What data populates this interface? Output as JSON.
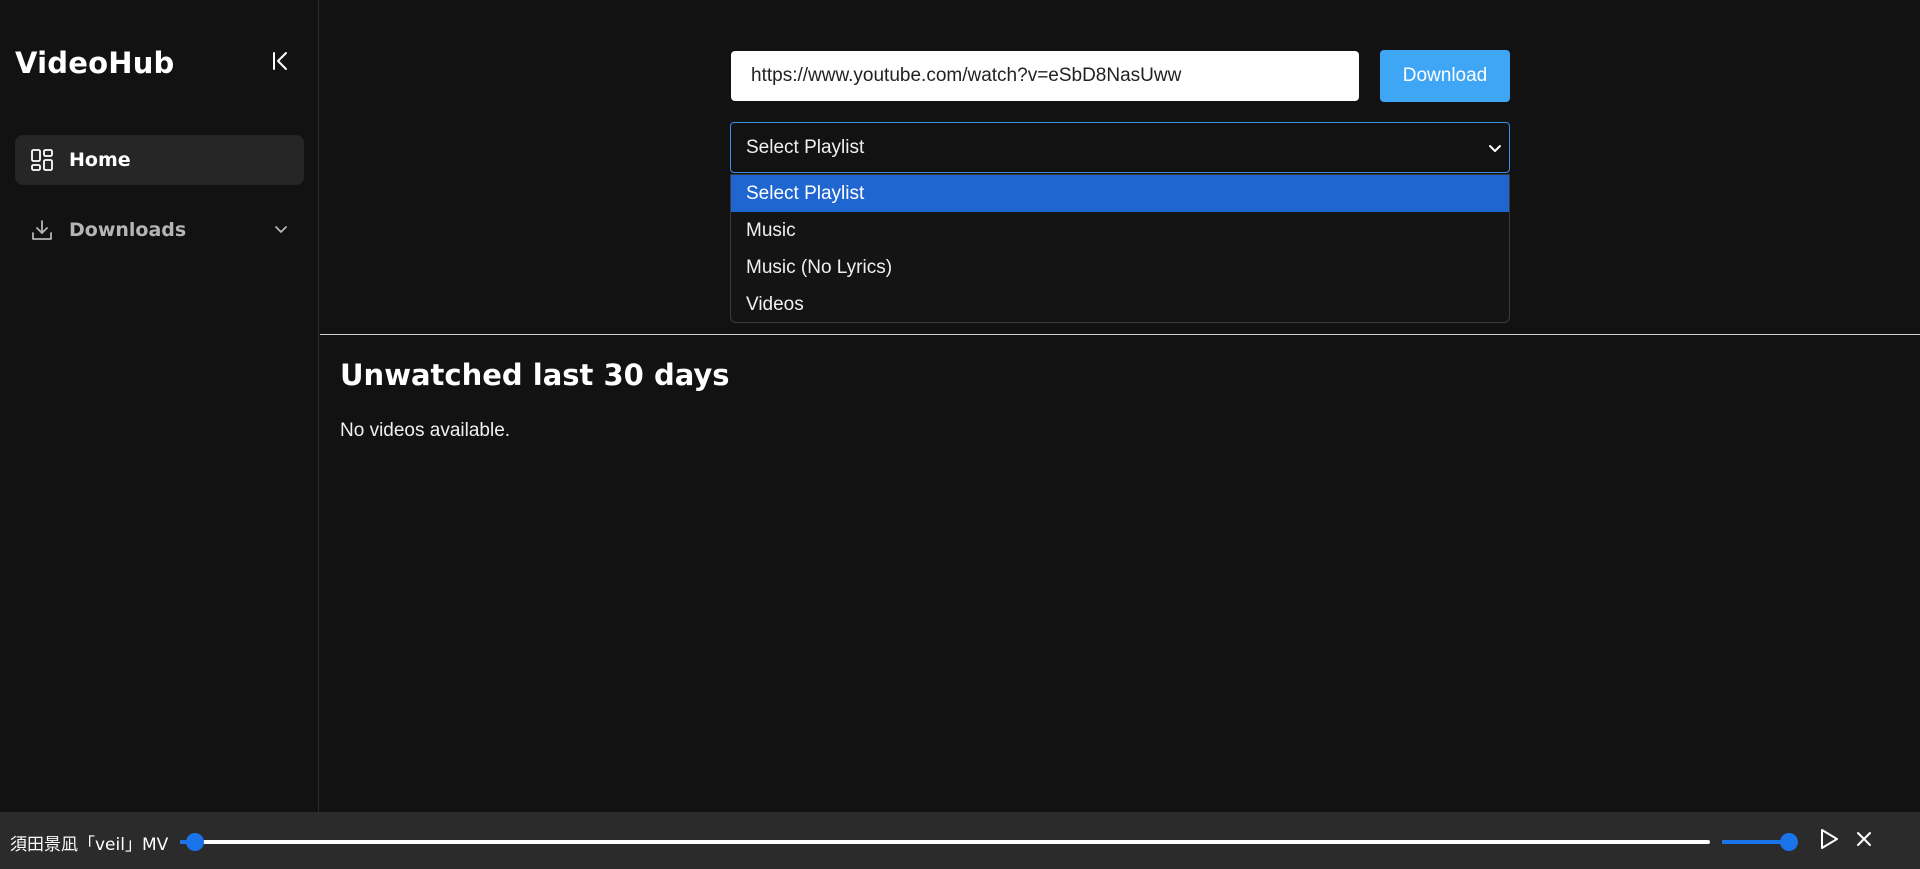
{
  "app": {
    "brand": "VideoHub",
    "collapse_icon": "collapse-sidebar-icon"
  },
  "sidebar": {
    "items": [
      {
        "label": "Home",
        "icon": "grid-icon",
        "active": true
      },
      {
        "label": "Downloads",
        "icon": "download-icon",
        "expandable": true
      }
    ]
  },
  "download_form": {
    "url_value": "https://www.youtube.com/watch?v=eSbD8NasUww",
    "download_label": "Download",
    "playlist_selected": "Select Playlist",
    "playlist_options": [
      "Select Playlist",
      "Music",
      "Music (No Lyrics)",
      "Videos"
    ]
  },
  "section": {
    "title": "Unwatched last 30 days",
    "empty_text": "No videos available."
  },
  "player": {
    "track_title": "須田景凪「veil」MV",
    "progress": 0.01,
    "volume": 1.0
  },
  "colors": {
    "accent": "#1a73e8",
    "download_button": "#3ea6f5",
    "selected_option": "#1f66d1",
    "background": "#121212",
    "player_bar": "#2b2b2b"
  }
}
